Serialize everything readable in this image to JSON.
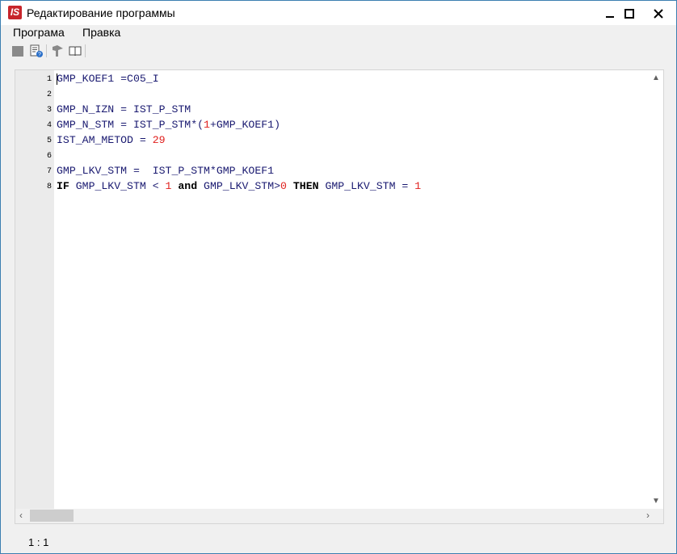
{
  "window": {
    "title": "Редактирование программы",
    "logo_text": "IS",
    "accent_color": "#c7252b",
    "controls": [
      "minimize-icon",
      "maximize-icon",
      "close-icon"
    ]
  },
  "menu": {
    "items": [
      "Програма",
      "Правка"
    ]
  },
  "toolbar": {
    "buttons": [
      "stop-icon",
      "document-help-icon",
      "pointer-icon",
      "book-icon"
    ]
  },
  "editor": {
    "lines": [
      {
        "num": "1",
        "tokens": [
          {
            "t": "GMP_KOEF1 =C05_I",
            "k": "id"
          }
        ]
      },
      {
        "num": "2",
        "tokens": []
      },
      {
        "num": "3",
        "tokens": [
          {
            "t": "GMP_N_IZN = IST_P_STM",
            "k": "id"
          }
        ]
      },
      {
        "num": "4",
        "tokens": [
          {
            "t": "GMP_N_STM = IST_P_STM*(",
            "k": "id"
          },
          {
            "t": "1",
            "k": "num"
          },
          {
            "t": "+GMP_KOEF1)",
            "k": "id"
          }
        ]
      },
      {
        "num": "5",
        "tokens": [
          {
            "t": "IST_AM_METOD = ",
            "k": "id"
          },
          {
            "t": "29",
            "k": "num"
          }
        ]
      },
      {
        "num": "6",
        "tokens": []
      },
      {
        "num": "7",
        "tokens": [
          {
            "t": "GMP_LKV_STM =  IST_P_STM*GMP_KOEF1",
            "k": "id"
          }
        ]
      },
      {
        "num": "8",
        "tokens": [
          {
            "t": "IF",
            "k": "kw"
          },
          {
            "t": " GMP_LKV_STM < ",
            "k": "id"
          },
          {
            "t": "1",
            "k": "num"
          },
          {
            "t": " ",
            "k": "id"
          },
          {
            "t": "and",
            "k": "kw"
          },
          {
            "t": " GMP_LKV_STM>",
            "k": "id"
          },
          {
            "t": "0",
            "k": "num"
          },
          {
            "t": " ",
            "k": "id"
          },
          {
            "t": "THEN",
            "k": "kw"
          },
          {
            "t": " GMP_LKV_STM = ",
            "k": "id"
          },
          {
            "t": "1",
            "k": "num"
          }
        ]
      }
    ]
  },
  "status": {
    "cursor_position": "1 : 1"
  }
}
